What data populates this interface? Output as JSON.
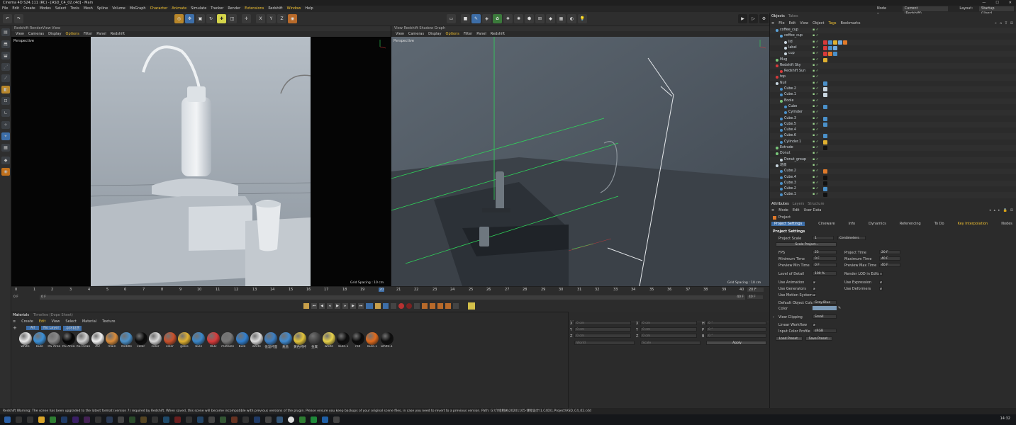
{
  "window": {
    "title": "Cinema 4D S24.111 (RC) - [ASD_C4_02.c4d] - Main"
  },
  "menubar": {
    "items": [
      "File",
      "Edit",
      "Create",
      "Modes",
      "Select",
      "Tools",
      "Mesh",
      "Spline",
      "Volume",
      "MoGraph",
      "Character",
      "Animate",
      "Simulate",
      "Tracker",
      "Render",
      "Extensions",
      "Redshift",
      "Window",
      "Help"
    ],
    "node_space_label": "Node Space:",
    "node_space_value": "Current (Redshift)",
    "layout_label": "Layout:",
    "layout_value": "Startup (User)"
  },
  "viewport_left": {
    "header": "Redshift RenderView  View",
    "menu": [
      "View",
      "Cameras",
      "Display",
      "Options",
      "Filter",
      "Panel",
      "Redshift"
    ],
    "camera": "Perspective",
    "grid_spacing": "Grid Spacing : 10 cm"
  },
  "viewport_right": {
    "header": "View  Redshift Shadow Graph",
    "menu": [
      "View",
      "Cameras",
      "Display",
      "Options",
      "Filter",
      "Panel",
      "Redshift"
    ],
    "camera": "Perspective",
    "grid_spacing": "Grid Spacing : 10 cm"
  },
  "timeline": {
    "ticks": [
      "0",
      "1",
      "2",
      "3",
      "4",
      "5",
      "6",
      "7",
      "8",
      "9",
      "10",
      "11",
      "12",
      "13",
      "14",
      "15",
      "16",
      "17",
      "18",
      "19",
      "20",
      "21",
      "22",
      "23",
      "24",
      "25",
      "26",
      "27",
      "28",
      "29",
      "30",
      "31",
      "32",
      "33",
      "34",
      "35",
      "36",
      "37",
      "38",
      "39",
      "40"
    ],
    "current_frame": "20 F",
    "start_frame": "0 F",
    "start_field": "0 F",
    "end_field": "40 F",
    "end_frame": "40 F",
    "end_frame_2": "40 F"
  },
  "materials": {
    "tabs": [
      "Materials",
      "Timeline (Dope Sheet)"
    ],
    "menu": [
      "Create",
      "Edit",
      "View",
      "Select",
      "Material",
      "Texture"
    ],
    "filters": [
      "All",
      "No Layer",
      "冷杯材质"
    ],
    "items": [
      {
        "label": "white",
        "color": "#e8e8e8"
      },
      {
        "label": "bule",
        "color": "#3a8fd6"
      },
      {
        "label": "RS Area",
        "color": "#888888"
      },
      {
        "label": "RS Area",
        "color": "#050505"
      },
      {
        "label": "RS Incan",
        "color": "#d0d0d0"
      },
      {
        "label": "AO",
        "color": "#f2f2f2"
      },
      {
        "label": "main",
        "color": "#d98b3a"
      },
      {
        "label": "middle",
        "color": "#4a90c9"
      },
      {
        "label": "color",
        "color": "#0a0a0a"
      },
      {
        "label": "color",
        "color": "#d8d8d8"
      },
      {
        "label": "color",
        "color": "#c9502a"
      },
      {
        "label": "galss",
        "color": "#e0b030"
      },
      {
        "label": "bule",
        "color": "#3a86c8"
      },
      {
        "label": "RED",
        "color": "#d83a3a"
      },
      {
        "label": "metales",
        "color": "#777777"
      },
      {
        "label": "bule",
        "color": "#2f7fd0"
      },
      {
        "label": "white",
        "color": "#dddddd"
      },
      {
        "label": "低温杯面",
        "color": "#3a7ec4"
      },
      {
        "label": "瓶盖",
        "color": "#3f8ad0"
      },
      {
        "label": "黄色杯杯",
        "color": "#e3c43a"
      },
      {
        "label": "金属",
        "color": "#444444"
      },
      {
        "label": "white",
        "color": "#e8d24a"
      },
      {
        "label": "bule.1",
        "color": "#0c0c0c"
      },
      {
        "label": "red",
        "color": "#0a0a0a"
      },
      {
        "label": "bule.1",
        "color": "#e06a1c"
      },
      {
        "label": "white.1",
        "color": "#0d0d0d"
      }
    ]
  },
  "coords": {
    "labels_left": [
      "X",
      "Y",
      "Z"
    ],
    "labels_mid": [
      "X",
      "Y",
      "Z"
    ],
    "labels_right": [
      "H",
      "P",
      "B"
    ],
    "values": [
      "0 cm",
      "0 cm",
      "0 cm",
      "0 cm",
      "0 cm",
      "0 cm",
      "0 °",
      "0 °",
      "0 °"
    ],
    "world": "World",
    "scale": "Scale",
    "apply": "Apply"
  },
  "objects": {
    "tabs": [
      "Objects",
      "Takes"
    ],
    "menu": [
      "File",
      "Edit",
      "View",
      "Object",
      "Tags",
      "Bookmarks"
    ],
    "rows": [
      {
        "name": "coffee_cup",
        "indent": 0,
        "icon": "#5ba3d9",
        "tags": []
      },
      {
        "name": "coffee_cup",
        "indent": 1,
        "icon": "#5ba3d9",
        "tags": []
      },
      {
        "name": "lid",
        "indent": 2,
        "icon": "#c9d6df",
        "tags": [
          "#d83a3a",
          "#4a90c9",
          "#e0b030",
          "#6fa8dc",
          "#e07a2a"
        ]
      },
      {
        "name": "label",
        "indent": 2,
        "icon": "#c9d6df",
        "tags": [
          "#d83a3a",
          "#4a90c9",
          "#6fa8dc"
        ]
      },
      {
        "name": "cup",
        "indent": 2,
        "icon": "#c9d6df",
        "tags": [
          "#d83a3a",
          "#e07a2a",
          "#4a90c9"
        ]
      },
      {
        "name": "Mug",
        "indent": 0,
        "icon": "#7ac77a",
        "tags": [
          "#e0b030"
        ]
      },
      {
        "name": "Redshift Sky",
        "indent": 0,
        "icon": "#d83a3a",
        "tags": []
      },
      {
        "name": "Redshift Sun",
        "indent": 1,
        "icon": "#d83a3a",
        "tags": []
      },
      {
        "name": "top",
        "indent": 0,
        "icon": "#d83a3a",
        "tags": []
      },
      {
        "name": "Null",
        "indent": 0,
        "icon": "#c9d6df",
        "tags": [
          "#4a90c9"
        ]
      },
      {
        "name": "Cube.2",
        "indent": 1,
        "icon": "#4a90c9",
        "tags": [
          "#c9d6df"
        ]
      },
      {
        "name": "Cube.1",
        "indent": 1,
        "icon": "#4a90c9",
        "tags": [
          "#c9d6df"
        ]
      },
      {
        "name": "Boole",
        "indent": 1,
        "icon": "#7ac77a",
        "tags": []
      },
      {
        "name": "Cube",
        "indent": 2,
        "icon": "#4a90c9",
        "tags": [
          "#4a90c9"
        ]
      },
      {
        "name": "Cylinder",
        "indent": 2,
        "icon": "#4a90c9",
        "tags": []
      },
      {
        "name": "Cube.3",
        "indent": 1,
        "icon": "#4a90c9",
        "tags": [
          "#4a90c9"
        ]
      },
      {
        "name": "Cube.5",
        "indent": 1,
        "icon": "#4a90c9",
        "tags": [
          "#4a90c9"
        ]
      },
      {
        "name": "Cube.4",
        "indent": 1,
        "icon": "#4a90c9",
        "tags": []
      },
      {
        "name": "Cube.6",
        "indent": 1,
        "icon": "#4a90c9",
        "tags": [
          "#4a90c9"
        ]
      },
      {
        "name": "Cylinder.1",
        "indent": 1,
        "icon": "#4a90c9",
        "tags": [
          "#e0b030"
        ]
      },
      {
        "name": "Extrude",
        "indent": 0,
        "icon": "#7ac77a",
        "tags": [
          "#111111"
        ]
      },
      {
        "name": "Donut",
        "indent": 0,
        "icon": "#7ac77a",
        "tags": []
      },
      {
        "name": "Donut_group",
        "indent": 1,
        "icon": "#c9d6df",
        "tags": []
      },
      {
        "name": "场景",
        "indent": 0,
        "icon": "#c9d6df",
        "tags": []
      },
      {
        "name": "Cube.2",
        "indent": 1,
        "icon": "#4a90c9",
        "tags": [
          "#e07a2a"
        ]
      },
      {
        "name": "Cube.4",
        "indent": 1,
        "icon": "#4a90c9",
        "tags": [
          "#111111"
        ]
      },
      {
        "name": "Cube.3",
        "indent": 1,
        "icon": "#4a90c9",
        "tags": [
          "#111111"
        ]
      },
      {
        "name": "Cube.2",
        "indent": 1,
        "icon": "#4a90c9",
        "tags": [
          "#4a90c9"
        ]
      },
      {
        "name": "Cube.1",
        "indent": 1,
        "icon": "#4a90c9",
        "tags": [
          "#111111"
        ]
      }
    ]
  },
  "attributes": {
    "tabs": [
      "Attributes",
      "Layers",
      "Structure"
    ],
    "menu": [
      "Mode",
      "Edit",
      "User Data"
    ],
    "object": "Project",
    "subtabs": [
      "Project Settings",
      "Cineware",
      "Info",
      "Dynamics",
      "Referencing",
      "To Do",
      "Key Interpolation",
      "Nodes"
    ],
    "section": "Project Settings",
    "project_scale_label": "Project Scale",
    "project_scale_value": "1",
    "project_scale_unit": "Centimeters",
    "scale_project_btn": "Scale Project...",
    "fps_label": "FPS",
    "fps": "25",
    "project_time_label": "Project Time",
    "project_time": "20 F",
    "min_time_label": "Minimum Time",
    "min_time": "0 F",
    "max_time_label": "Maximum Time",
    "max_time": "40 F",
    "preview_min_label": "Preview Min Time",
    "preview_min": "0 F",
    "preview_max_label": "Preview Max Time",
    "preview_max": "40 F",
    "lod_label": "Level of Detail",
    "lod": "100 %",
    "render_lod_label": "Render LOD in Editor",
    "use_animation": "Use Animation",
    "use_expression": "Use Expression",
    "use_generators": "Use Generators",
    "use_deformers": "Use Deformers",
    "use_motion": "Use Motion System",
    "default_color_label": "Default Object Color",
    "default_color_value": "Gray-Blue",
    "color_label": "Color",
    "view_clipping_label": "View Clipping",
    "view_clipping_value": "Small",
    "linear_workflow_label": "Linear Workflow",
    "input_profile_label": "Input Color Profile",
    "input_profile_value": "sRGB",
    "load_preset": "Load Preset...",
    "save_preset": "Save Preset..."
  },
  "status": {
    "text": "Redshift Warning: The scene has been upgraded to the latest format (version 7) required by Redshift. When saved, this scene will become incompatible with previous versions of the plugin. Please ensure you keep backups of your original scene files, in case you need to revert to a previous version. Path: G:\\介绍相关\\20201105-课程设计\\1.C4D\\1.Project\\ASD_C4_02.c4d"
  },
  "taskbar": {
    "time": "14:32"
  },
  "colors": {
    "accent": "#f0c030",
    "active_tab": "#3d6ea8",
    "grid_green": "#2fd65a",
    "selection": "#3b5f87"
  }
}
